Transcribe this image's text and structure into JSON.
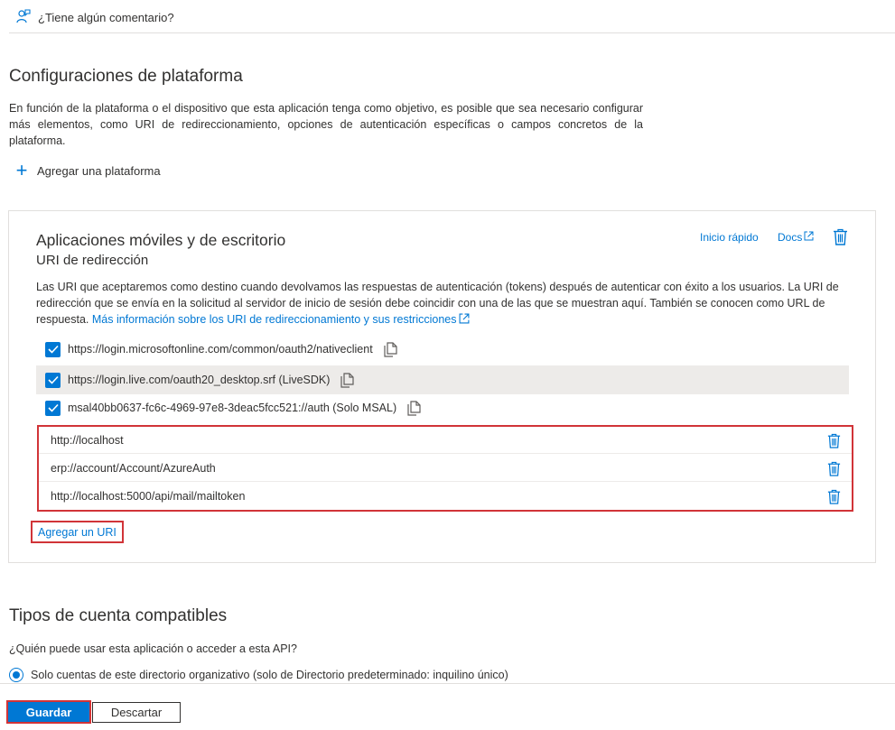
{
  "feedback": {
    "label": "¿Tiene algún comentario?",
    "icon": "feedback-person-icon"
  },
  "platform_section": {
    "title": "Configuraciones de plataforma",
    "description": "En función de la plataforma o el dispositivo que esta aplicación tenga como objetivo, es posible que sea necesario configurar más elementos, como URI de redireccionamiento, opciones de autenticación específicas o campos concretos de la plataforma.",
    "add_platform_label": "Agregar una plataforma"
  },
  "platform_card": {
    "title": "Aplicaciones móviles y de escritorio",
    "subtitle": "URI de redirección",
    "quickstart_label": "Inicio rápido",
    "docs_label": "Docs",
    "description": "Las URI que aceptaremos como destino cuando devolvamos las respuestas de autenticación (tokens) después de autenticar con éxito a los usuarios. La URI de redirección que se envía en la solicitud al servidor de inicio de sesión debe coincidir con una de las que se muestran aquí. También se conocen como URL de respuesta.",
    "more_info_link": "Más información sobre los URI de redireccionamiento y sus restricciones",
    "suggested_uris": [
      {
        "uri": "https://login.microsoftonline.com/common/oauth2/nativeclient",
        "checked": true
      },
      {
        "uri": "https://login.live.com/oauth20_desktop.srf (LiveSDK)",
        "checked": true
      },
      {
        "uri": "msal40bb0637-fc6c-4969-97e8-3deac5fcc521://auth (Solo MSAL)",
        "checked": true
      }
    ],
    "custom_uris": [
      "http://localhost",
      "erp://account/Account/AzureAuth",
      "http://localhost:5000/api/mail/mailtoken"
    ],
    "add_uri_label": "Agregar un URI"
  },
  "account_section": {
    "title": "Tipos de cuenta compatibles",
    "question": "¿Quién puede usar esta aplicación o acceder a esta API?",
    "selected_option": "Solo cuentas de este directorio organizativo (solo de Directorio predeterminado: inquilino único)"
  },
  "footer": {
    "save_label": "Guardar",
    "discard_label": "Descartar"
  },
  "colors": {
    "accent": "#0078d4",
    "highlight_border": "#d13438",
    "text": "#323130"
  }
}
